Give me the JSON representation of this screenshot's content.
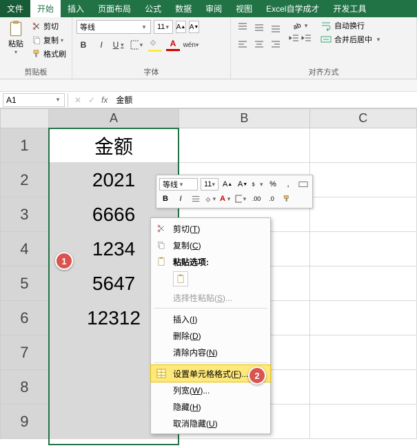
{
  "tabs": {
    "file": "文件",
    "home": "开始",
    "insert": "插入",
    "layout": "页面布局",
    "formula": "公式",
    "data": "数据",
    "review": "审阅",
    "view": "视图",
    "self": "Excel自学成才",
    "dev": "开发工具"
  },
  "ribbon": {
    "clipboard": {
      "label": "剪贴板",
      "paste": "粘贴",
      "cut": "剪切",
      "copy": "复制",
      "painter": "格式刷"
    },
    "font": {
      "label": "字体",
      "name": "等线",
      "size": "11"
    },
    "align": {
      "label": "对齐方式",
      "wrap": "自动换行",
      "merge": "合并后居中"
    }
  },
  "formula_bar": {
    "cell_ref": "A1",
    "value": "金额"
  },
  "sheet": {
    "cols": [
      "A",
      "B",
      "C"
    ],
    "rows": [
      "1",
      "2",
      "3",
      "4",
      "5",
      "6",
      "7",
      "8",
      "9"
    ],
    "colA": [
      "金额",
      "2021",
      "6666",
      "1234",
      "5647",
      "12312",
      "",
      "",
      ""
    ]
  },
  "mini_toolbar": {
    "font": "等线",
    "size": "11"
  },
  "context_menu": {
    "cut": "剪切(T)",
    "copy": "复制(C)",
    "paste_opts": "粘贴选项:",
    "paste_special": "选择性粘贴(S)...",
    "insert": "插入(I)",
    "delete": "删除(D)",
    "clear": "清除内容(N)",
    "format": "设置单元格格式(F)...",
    "colwidth": "列宽(W)...",
    "hide": "隐藏(H)",
    "unhide": "取消隐藏(U)"
  },
  "callouts": {
    "one": "1",
    "two": "2"
  }
}
